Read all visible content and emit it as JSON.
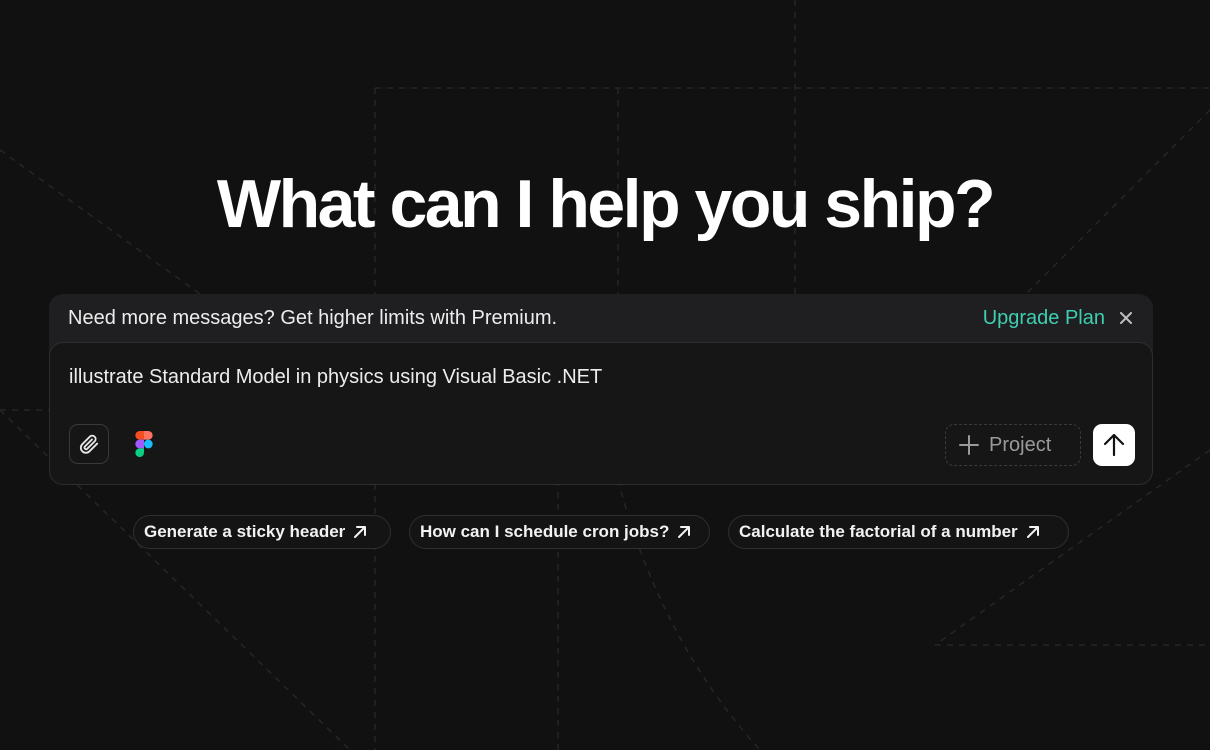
{
  "headline": "What can I help you ship?",
  "banner": {
    "message": "Need more messages? Get higher limits with Premium.",
    "upgrade_label": "Upgrade Plan",
    "close_icon": "close-icon",
    "accent_color": "#3ecfb0"
  },
  "composer": {
    "prompt_value": "illustrate Standard Model in physics using Visual Basic .NET",
    "attach_icon": "paperclip-icon",
    "figma_icon": "figma-icon",
    "project_label": "Project",
    "project_icon": "plus-icon",
    "send_icon": "arrow-up-icon"
  },
  "suggestions": [
    {
      "label": "Generate a sticky header",
      "icon": "arrow-up-right-icon"
    },
    {
      "label": "How can I schedule cron jobs?",
      "icon": "arrow-up-right-icon"
    },
    {
      "label": "Calculate the factorial of a number",
      "icon": "arrow-up-right-icon"
    }
  ],
  "colors": {
    "background": "#111111",
    "surface": "#161616",
    "banner": "#1f1f21",
    "text": "#ededed",
    "accent": "#3ecfb0"
  }
}
